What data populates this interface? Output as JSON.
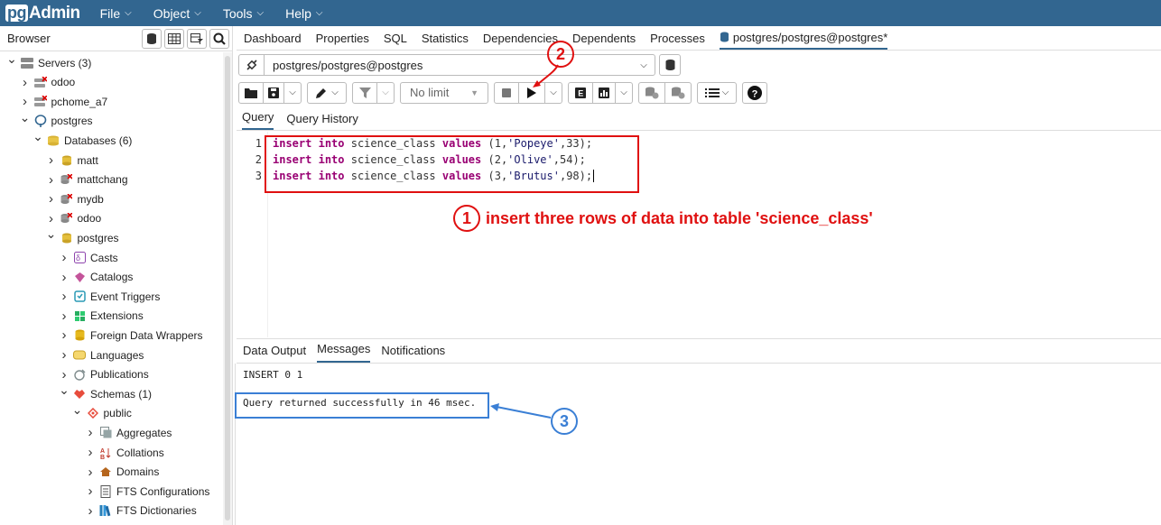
{
  "app": {
    "logo_prefix": "pg",
    "logo_suffix": "Admin"
  },
  "menu": [
    "File",
    "Object",
    "Tools",
    "Help"
  ],
  "browser": {
    "title": "Browser"
  },
  "tree": [
    {
      "label": "Servers (3)",
      "depth": 0,
      "expanded": true,
      "icon": "servers-icon"
    },
    {
      "label": "odoo",
      "depth": 1,
      "expanded": false,
      "icon": "server-disconnected-icon"
    },
    {
      "label": "pchome_a7",
      "depth": 1,
      "expanded": false,
      "icon": "server-disconnected-icon"
    },
    {
      "label": "postgres",
      "depth": 1,
      "expanded": true,
      "icon": "postgres-elephant-icon"
    },
    {
      "label": "Databases (6)",
      "depth": 2,
      "expanded": true,
      "icon": "databases-icon"
    },
    {
      "label": "matt",
      "depth": 3,
      "expanded": false,
      "icon": "database-icon"
    },
    {
      "label": "mattchang",
      "depth": 3,
      "expanded": false,
      "icon": "database-disconnected-icon"
    },
    {
      "label": "mydb",
      "depth": 3,
      "expanded": false,
      "icon": "database-disconnected-icon"
    },
    {
      "label": "odoo",
      "depth": 3,
      "expanded": false,
      "icon": "database-disconnected-icon"
    },
    {
      "label": "postgres",
      "depth": 3,
      "expanded": true,
      "icon": "database-icon"
    },
    {
      "label": "Casts",
      "depth": 4,
      "expanded": false,
      "icon": "casts-icon"
    },
    {
      "label": "Catalogs",
      "depth": 4,
      "expanded": false,
      "icon": "catalogs-icon"
    },
    {
      "label": "Event Triggers",
      "depth": 4,
      "expanded": false,
      "icon": "event-triggers-icon"
    },
    {
      "label": "Extensions",
      "depth": 4,
      "expanded": false,
      "icon": "extensions-icon"
    },
    {
      "label": "Foreign Data Wrappers",
      "depth": 4,
      "expanded": false,
      "icon": "fdw-icon"
    },
    {
      "label": "Languages",
      "depth": 4,
      "expanded": false,
      "icon": "languages-icon"
    },
    {
      "label": "Publications",
      "depth": 4,
      "expanded": false,
      "icon": "publications-icon"
    },
    {
      "label": "Schemas (1)",
      "depth": 4,
      "expanded": true,
      "icon": "schemas-icon"
    },
    {
      "label": "public",
      "depth": 5,
      "expanded": true,
      "icon": "schema-icon"
    },
    {
      "label": "Aggregates",
      "depth": 6,
      "expanded": false,
      "icon": "aggregates-icon"
    },
    {
      "label": "Collations",
      "depth": 6,
      "expanded": false,
      "icon": "collations-icon"
    },
    {
      "label": "Domains",
      "depth": 6,
      "expanded": false,
      "icon": "domains-icon"
    },
    {
      "label": "FTS Configurations",
      "depth": 6,
      "expanded": false,
      "icon": "fts-config-icon"
    },
    {
      "label": "FTS Dictionaries",
      "depth": 6,
      "expanded": false,
      "icon": "fts-dict-icon"
    }
  ],
  "tabs": [
    "Dashboard",
    "Properties",
    "SQL",
    "Statistics",
    "Dependencies",
    "Dependents",
    "Processes",
    "postgres/postgres@postgres*"
  ],
  "connection": {
    "value": "postgres/postgres@postgres"
  },
  "toolbar": {
    "limit": "No limit"
  },
  "query_tabs": [
    "Query",
    "Query History"
  ],
  "code": [
    {
      "n": "1",
      "id": "1",
      "name": "'Popeye'",
      "age": "33"
    },
    {
      "n": "2",
      "id": "2",
      "name": "'Olive'",
      "age": "54"
    },
    {
      "n": "3",
      "id": "3",
      "name": "'Brutus'",
      "age": "98"
    }
  ],
  "sql": {
    "kw_insert": "insert",
    "kw_into": "into",
    "table": "science_class",
    "kw_values": "values"
  },
  "output_tabs": [
    "Data Output",
    "Messages",
    "Notifications"
  ],
  "messages": {
    "line1": "INSERT 0 1",
    "line2": "Query returned successfully in 46 msec."
  },
  "annotations": {
    "a1_num": "1",
    "a1_text": "insert three rows of data into table 'science_class'",
    "a2_num": "2",
    "a3_num": "3"
  }
}
